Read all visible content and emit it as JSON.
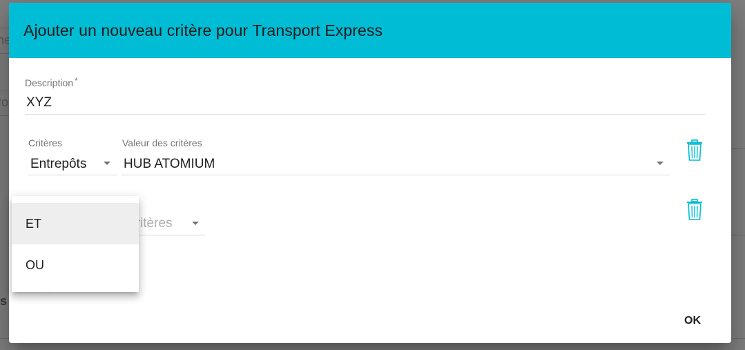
{
  "background": {
    "partial_texts": [
      "he",
      "ro",
      "s"
    ]
  },
  "dialog": {
    "title": "Ajouter un nouveau critère pour Transport Express",
    "header_color": "#00bcd4",
    "description": {
      "label": "Description",
      "required_mark": "*",
      "value": "XYZ"
    },
    "criteria_row_1": {
      "criteria_label": "Critères",
      "criteria_value": "Entrepôts",
      "value_label": "Valeur des critères",
      "value_value": "HUB ATOMIUM",
      "delete_icon": "trash-icon"
    },
    "criteria_row_2": {
      "criteria_placeholder": "Critères",
      "delete_icon": "trash-icon"
    },
    "ok_label": "OK"
  },
  "operator_menu": {
    "items": [
      "ET",
      "OU"
    ],
    "highlighted": "ET"
  },
  "accent_color": "#00bcd4"
}
